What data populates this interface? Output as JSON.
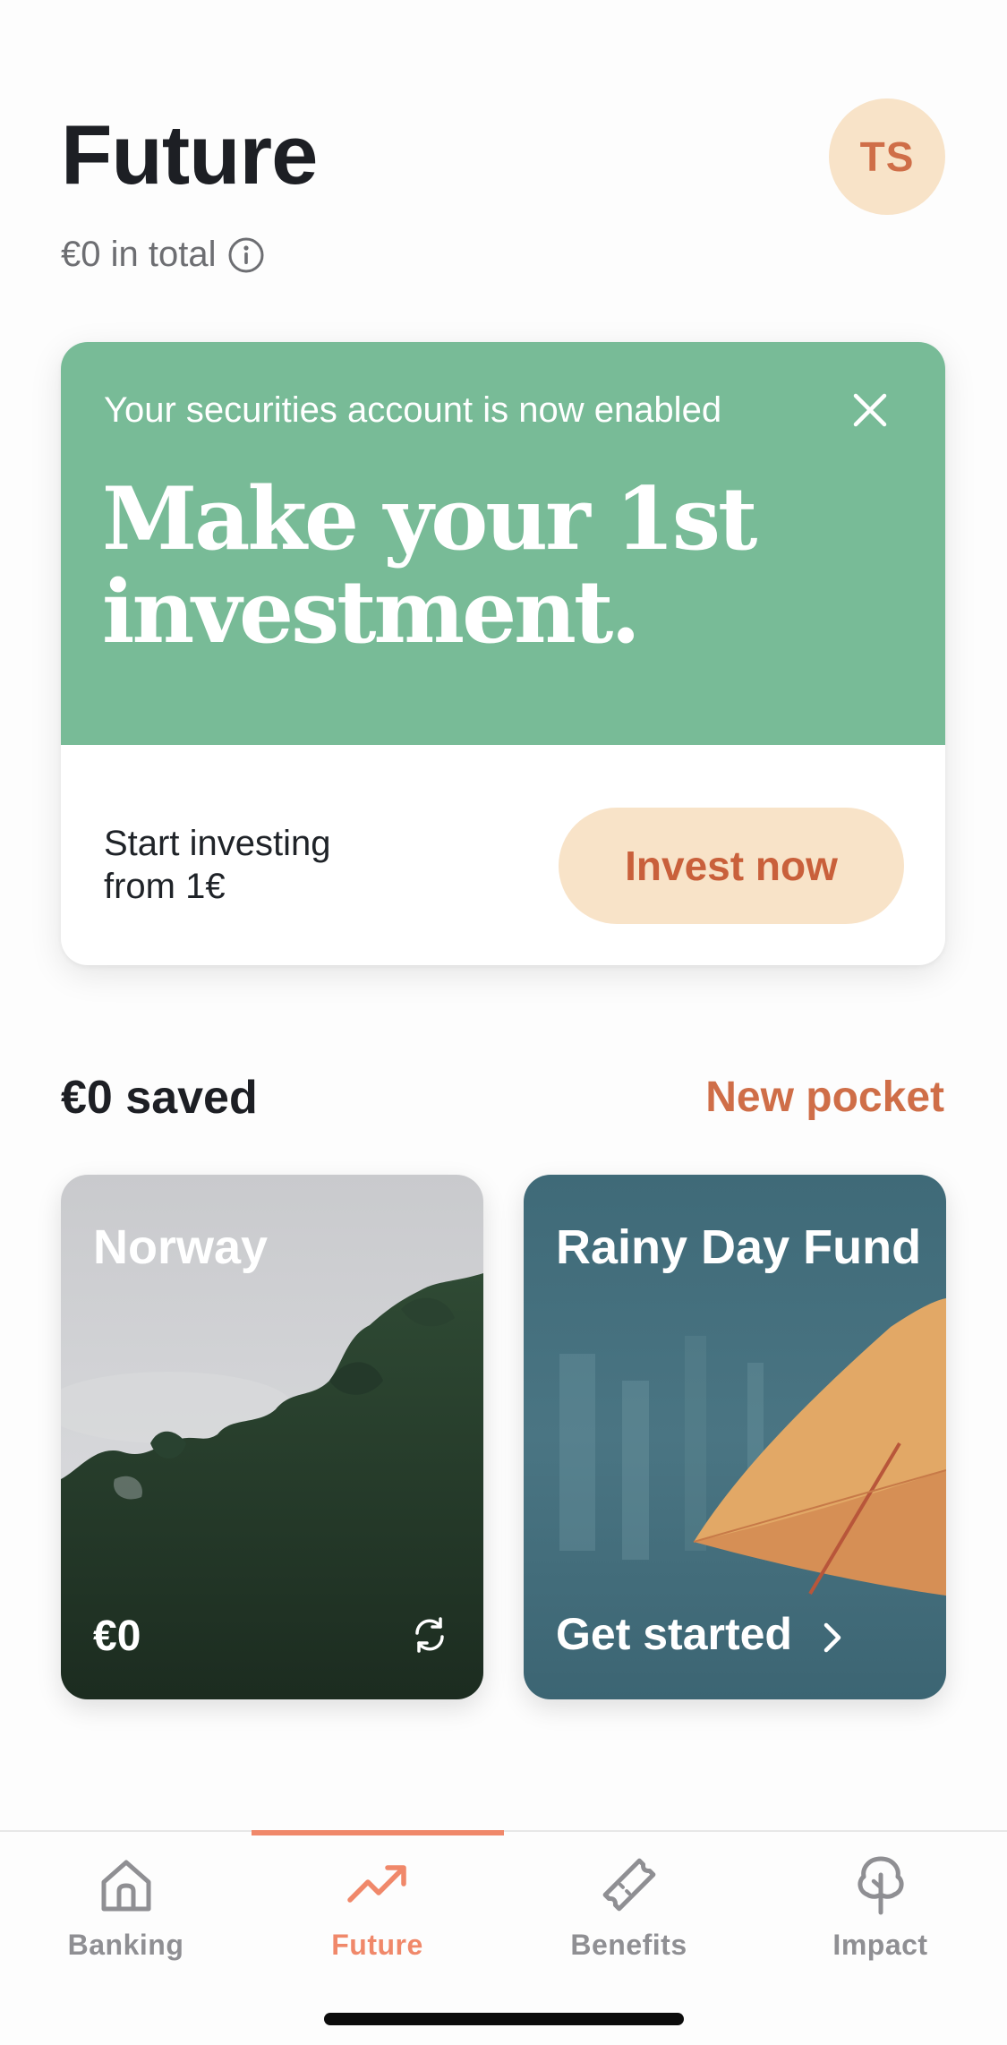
{
  "header": {
    "title": "Future",
    "total": "€0 in total",
    "avatar_initials": "TS"
  },
  "promo": {
    "eyebrow": "Your securities account is now enabled",
    "headline_line1": "Make your 1st",
    "headline_line2": "investment.",
    "body_line1": "Start investing",
    "body_line2": "from 1€",
    "cta": "Invest now",
    "bg_color": "#78bb97",
    "cta_bg_color": "#f8e3c8",
    "cta_text_color": "#c9603b"
  },
  "savings": {
    "title": "€0 saved",
    "new_pocket": "New pocket",
    "pockets": [
      {
        "name": "Norway",
        "amount": "€0",
        "icon": "recurring-icon"
      },
      {
        "name": "Rainy Day Fund",
        "cta": "Get started",
        "icon": "chevron-right-icon"
      }
    ]
  },
  "tabbar": {
    "active": "Future",
    "accent_color": "#f0886a",
    "tabs": [
      {
        "label": "Banking",
        "icon": "home-icon"
      },
      {
        "label": "Future",
        "icon": "trend-up-icon"
      },
      {
        "label": "Benefits",
        "icon": "ticket-icon"
      },
      {
        "label": "Impact",
        "icon": "tree-icon"
      }
    ]
  }
}
